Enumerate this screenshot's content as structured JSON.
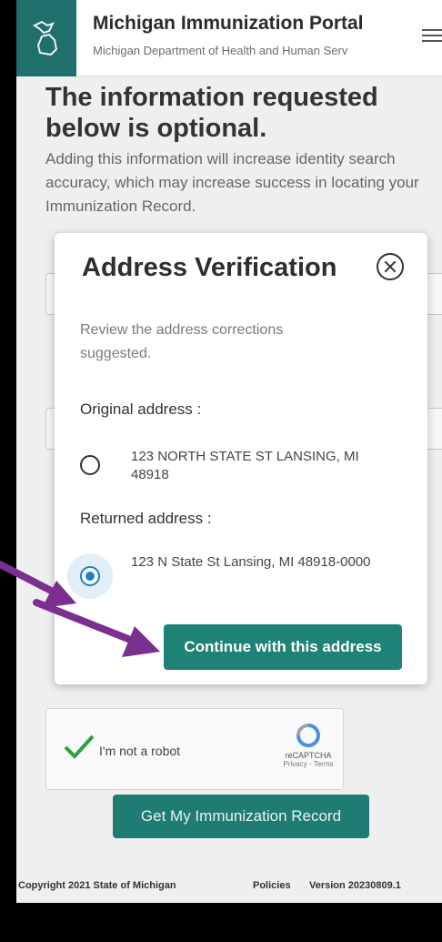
{
  "header": {
    "title": "Michigan Immunization Portal",
    "subtitle": "Michigan Department of Health and Human Serv"
  },
  "page": {
    "heading": "The information requested below is optional.",
    "intro": "Adding this information will increase identity search accuracy, which may increase success in locating your Immunization Record."
  },
  "modal": {
    "title": "Address Verification",
    "description": "Review the address corrections suggested.",
    "original_label": "Original address :",
    "original_address": "123 NORTH STATE ST LANSING, MI 48918",
    "returned_label": "Returned address :",
    "returned_address": "123 N State St Lansing, MI 48918-0000",
    "selected": "returned",
    "continue_label": "Continue with this address"
  },
  "captcha": {
    "label": "I'm not a robot",
    "brand": "reCAPTCHA",
    "links": "Privacy - Terms"
  },
  "get_record_label": "Get My Immunization Record",
  "footer": {
    "copyright": "Copyright 2021 State of Michigan",
    "policies": "Policies",
    "version": "Version 20230809.1"
  },
  "colors": {
    "accent": "#1f8276",
    "arrow": "#7b2f8f",
    "radio_selected": "#1f7fc8"
  }
}
